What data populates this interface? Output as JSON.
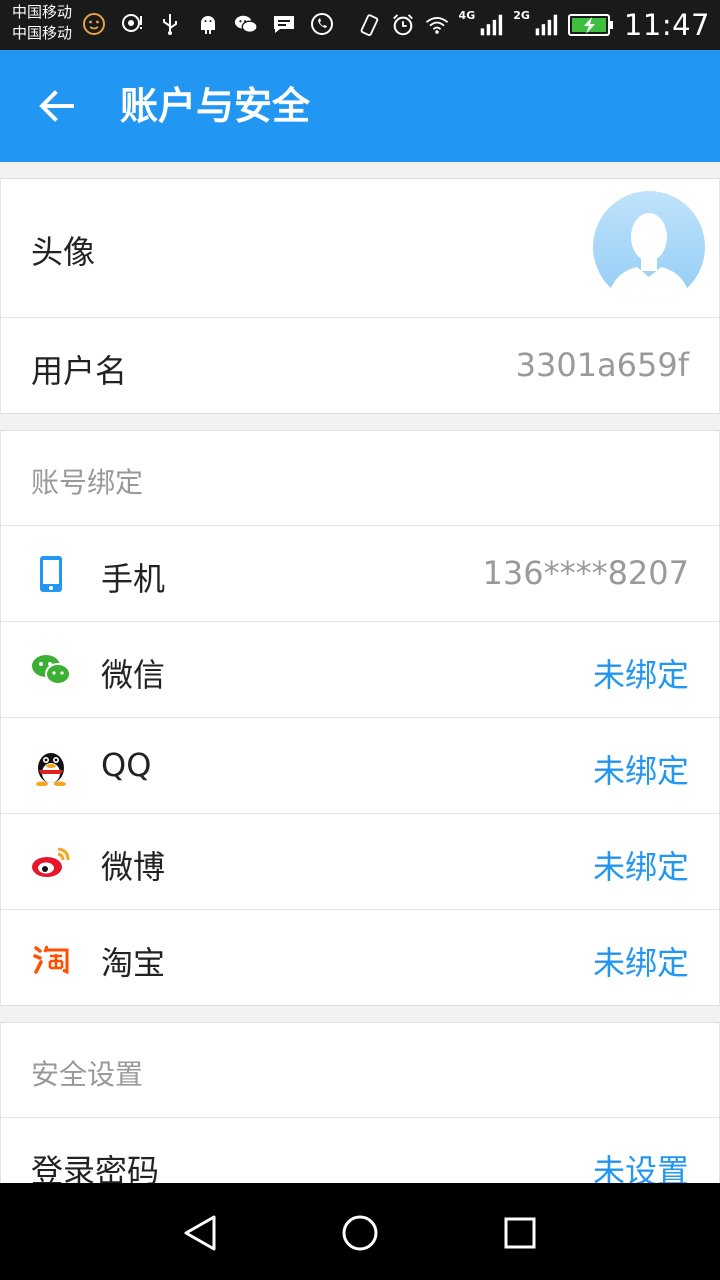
{
  "status_bar": {
    "carrier_1": "中国移动",
    "carrier_2": "中国移动",
    "network_1": "4G",
    "network_2": "2G",
    "time": "11:47",
    "icons": [
      "face-icon",
      "location-icon",
      "usb-icon",
      "android-icon",
      "wechat-icon",
      "message-icon",
      "whatsapp-icon",
      "vibrate-icon",
      "alarm-icon",
      "wifi-icon",
      "signal-icon",
      "battery-charging-icon"
    ]
  },
  "header": {
    "title": "账户与安全",
    "back_icon": "back-arrow-icon"
  },
  "profile": {
    "avatar_label": "头像",
    "username_label": "用户名",
    "username_value": "3301a659f"
  },
  "binding": {
    "section_title": "账号绑定",
    "items": [
      {
        "icon": "phone-icon",
        "label": "手机",
        "value": "136****8207",
        "status": "bound"
      },
      {
        "icon": "wechat-icon",
        "label": "微信",
        "value": "未绑定",
        "status": "unbound"
      },
      {
        "icon": "qq-icon",
        "label": "QQ",
        "value": "未绑定",
        "status": "unbound"
      },
      {
        "icon": "weibo-icon",
        "label": "微博",
        "value": "未绑定",
        "status": "unbound"
      },
      {
        "icon": "taobao-icon",
        "label": "淘宝",
        "value": "未绑定",
        "status": "unbound"
      }
    ]
  },
  "security": {
    "section_title": "安全设置",
    "items": [
      {
        "label": "登录密码",
        "value": "未设置"
      }
    ]
  },
  "nav_bar": {
    "buttons": [
      "back-triangle-icon",
      "home-circle-icon",
      "recents-square-icon"
    ]
  },
  "colors": {
    "accent": "#2196f3",
    "status_bar": "#1a1a1a",
    "link": "#2196f3",
    "muted": "#9a9a9a"
  }
}
